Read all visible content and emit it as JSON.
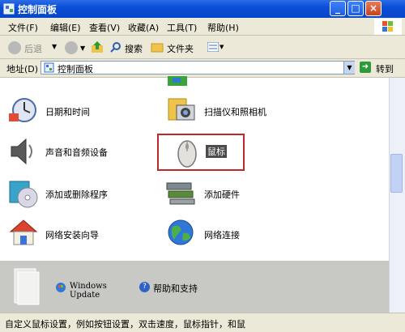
{
  "window": {
    "title": "控制面板",
    "min_glyph": "_",
    "max_glyph": "□",
    "close_glyph": "×"
  },
  "menu": {
    "items": [
      "文件(F)",
      "编辑(E)",
      "查看(V)",
      "收藏(A)",
      "工具(T)",
      "帮助(H)"
    ]
  },
  "toolbar": {
    "back_label": "后退",
    "search_label": "搜索",
    "folders_label": "文件夹"
  },
  "address": {
    "label": "地址(D)",
    "value": "控制面板",
    "go_label": "转到"
  },
  "items": [
    {
      "label": "日期和时间",
      "icon": "clock-icon"
    },
    {
      "label": "扫描仪和照相机",
      "icon": "scanner-camera-icon"
    },
    {
      "label": "声音和音频设备",
      "icon": "speaker-icon"
    },
    {
      "label": "鼠标",
      "icon": "mouse-icon"
    },
    {
      "label": "添加或删除程序",
      "icon": "cd-box-icon"
    },
    {
      "label": "添加硬件",
      "icon": "hardware-icon"
    },
    {
      "label": "网络安装向导",
      "icon": "house-icon"
    },
    {
      "label": "网络连接",
      "icon": "globe-icon"
    }
  ],
  "see_also": {
    "windows_update": "Windows Update",
    "help": "帮助和支持"
  },
  "status": {
    "text": "自定义鼠标设置，例如按钮设置，双击速度，鼠标指针，和鼠"
  },
  "colors": {
    "titlebar": "#0a4fd8",
    "highlight_box": "#c0272d",
    "chrome": "#ece9d8"
  }
}
